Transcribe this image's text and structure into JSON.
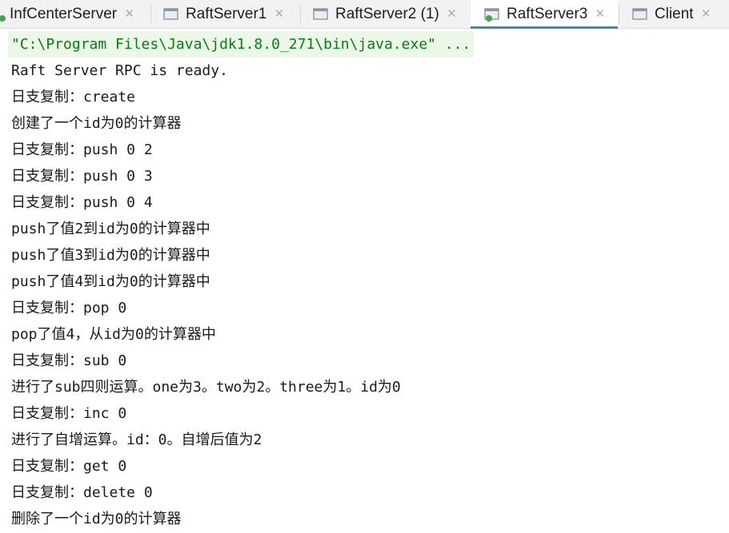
{
  "tabs": [
    {
      "label": "InfCenterServer",
      "icon": "run-config-icon",
      "active": false,
      "close": "×"
    },
    {
      "label": "RaftServer1",
      "icon": "run-config-icon",
      "active": false,
      "close": "×"
    },
    {
      "label": "RaftServer2 (1)",
      "icon": "run-config-icon",
      "active": false,
      "close": "×"
    },
    {
      "label": "RaftServer3",
      "icon": "run-config-running-icon",
      "active": true,
      "close": "×"
    },
    {
      "label": "Client",
      "icon": "run-config-icon",
      "active": false,
      "close": "×"
    }
  ],
  "console": {
    "command": "\"C:\\Program Files\\Java\\jdk1.8.0_271\\bin\\java.exe\" ...",
    "lines": [
      "Raft Server RPC is ready.",
      "日支复制：create",
      "创建了一个id为0的计算器",
      "日支复制：push 0 2",
      "日支复制：push 0 3",
      "日支复制：push 0 4",
      "push了值2到id为0的计算器中",
      "push了值3到id为0的计算器中",
      "push了值4到id为0的计算器中",
      "日支复制：pop 0",
      "pop了值4，从id为0的计算器中",
      "日支复制：sub 0",
      "进行了sub四则运算。one为3。two为2。three为1。id为0",
      "日支复制：inc 0",
      "进行了自增运算。id：0。自增后值为2",
      "日支复制：get 0",
      "日支复制：delete 0",
      "删除了一个id为0的计算器"
    ]
  },
  "colors": {
    "accent": "#4083c9",
    "command_text": "#067d17",
    "command_bg": "#edf7e7",
    "running_dot": "#3fa845"
  }
}
